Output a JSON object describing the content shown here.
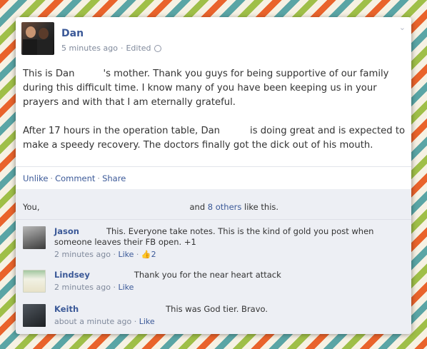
{
  "post": {
    "author": "Dan",
    "time": "5 minutes ago",
    "edited": "Edited",
    "p1_a": "This is Dan",
    "p1_b": "'s mother. Thank you guys for being supportive of our family during this difficult time. I know many of you have been keeping us in your prayers and with that I am eternally grateful.",
    "p2_a": "After 17 hours in the operation table, Dan",
    "p2_b": "is doing great and is expected to make a speedy recovery. The doctors finally got the dick out of his mouth."
  },
  "actions": {
    "unlike": "Unlike",
    "comment": "Comment",
    "share": "Share",
    "sep": "·"
  },
  "likes": {
    "you": "You,",
    "and": "and",
    "others": "8 others",
    "tail": "like this."
  },
  "comments": [
    {
      "name": "Jason",
      "text_a": "This. Everyone take notes. This is the kind of gold you post when",
      "text_b": "someone leaves their FB open. +1",
      "time": "2 minutes ago",
      "like": "Like",
      "likes_count": "2"
    },
    {
      "name": "Lindsey",
      "text_a": "Thank you for the near heart attack",
      "time": "2 minutes ago",
      "like": "Like"
    },
    {
      "name": "Keith",
      "text_a": "This was God tier. Bravo.",
      "time": "about a minute ago",
      "like": "Like"
    }
  ]
}
